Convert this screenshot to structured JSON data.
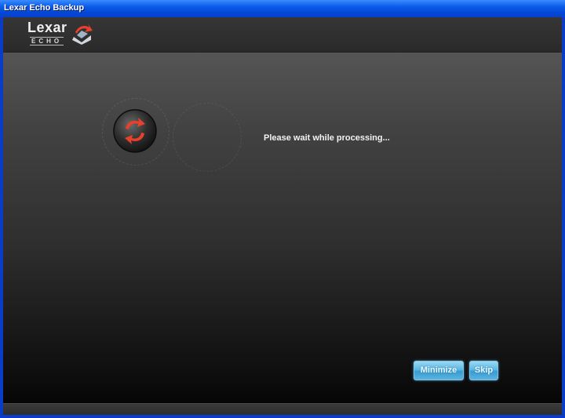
{
  "window": {
    "title": "Lexar Echo Backup"
  },
  "logo": {
    "word": "Lexar",
    "subtitle": "ECHO",
    "mark_icon": "echo-arrow-logo-icon"
  },
  "status": {
    "message": "Please wait while processing...",
    "icon": "sync-arrows-icon"
  },
  "buttons": {
    "minimize": "Minimize",
    "skip": "Skip"
  },
  "colors": {
    "accent_red": "#e8402a",
    "button_blue": "#5cb8e4",
    "title_blue": "#0a5ae8"
  }
}
